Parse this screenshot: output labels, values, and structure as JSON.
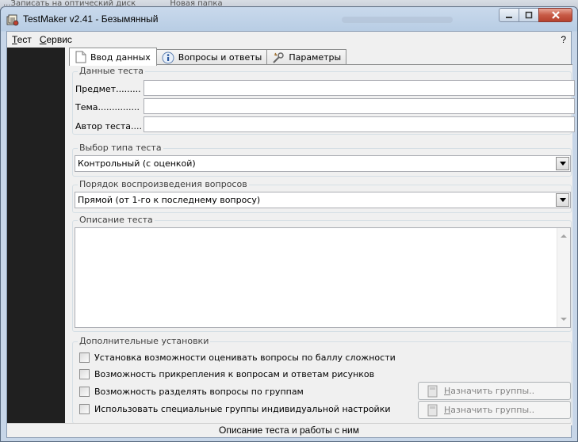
{
  "window": {
    "title": "TestMaker v2.41 - Безымянный",
    "accent_titlebar": "#c9d9ec",
    "close_color": "#c75a45"
  },
  "background_strip": [
    "...Записать на оптический диск",
    "Новая папка"
  ],
  "menu": {
    "items": [
      {
        "mnemonic": "Т",
        "rest": "ест"
      },
      {
        "mnemonic": "С",
        "rest": "ервис"
      }
    ],
    "help": "?"
  },
  "tabs": [
    {
      "label": "Ввод данных",
      "icon": "document-icon",
      "active": true
    },
    {
      "label": "Вопросы и ответы",
      "icon": "info-icon",
      "active": false
    },
    {
      "label": "Параметры",
      "icon": "settings-tool-icon",
      "active": false
    }
  ],
  "test_data": {
    "legend": "Данные теста",
    "subject_label": "Предмет.........",
    "subject_value": "",
    "topic_label": "Тема...............",
    "topic_value": "",
    "author_label": "Автор теста....",
    "author_value": ""
  },
  "test_type": {
    "legend": "Выбор типа теста",
    "selected": "Контрольный (с оценкой)"
  },
  "question_order": {
    "legend": "Порядок воспроизведения вопросов",
    "selected": "Прямой (от 1-го к последнему вопросу)"
  },
  "description": {
    "legend": "Описание теста",
    "value": ""
  },
  "additional": {
    "legend": "Дополнительные установки",
    "options": [
      {
        "label": "Установка возможности оценивать вопросы по баллу сложности",
        "checked": false
      },
      {
        "label": "Возможность прикрепления к вопросам и ответам рисунков",
        "checked": false
      },
      {
        "label": "Возможность разделять вопросы по группам",
        "checked": false
      },
      {
        "label": "Использовать специальные группы индивидуальной настройки",
        "checked": false
      }
    ],
    "assign_button": {
      "mnemonic": "Н",
      "rest": "азначить группы.."
    }
  },
  "status": "Описание теста и работы с ним"
}
